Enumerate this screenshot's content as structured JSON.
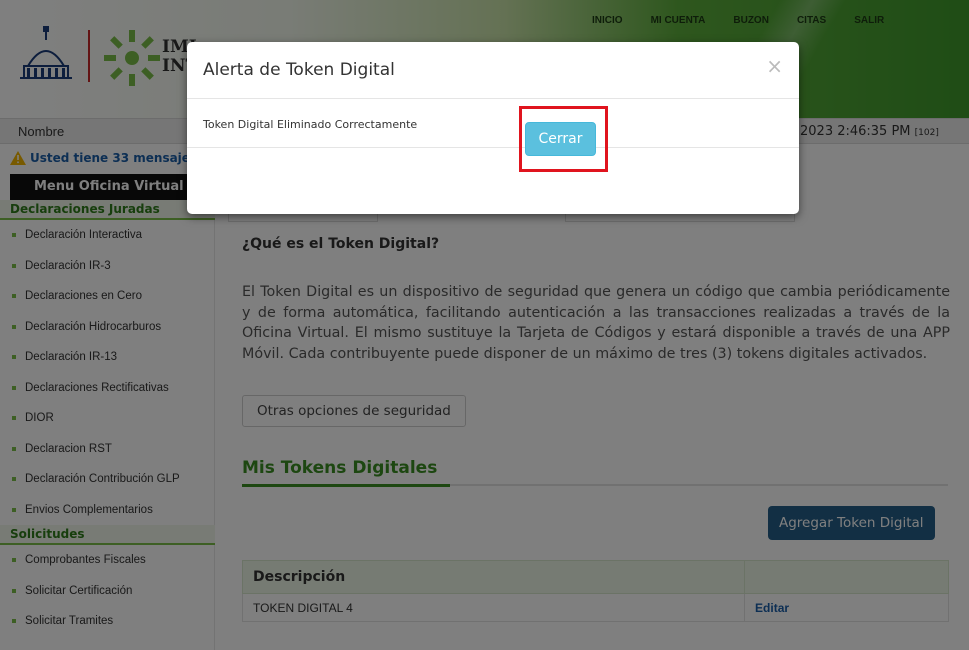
{
  "top_nav": [
    "INICIO",
    "MI CUENTA",
    "BUZON",
    "CITAS",
    "SALIR"
  ],
  "logo": {
    "text_line1": "IMI",
    "text_line2": "INT"
  },
  "info_bar": {
    "name_label": "Nombre",
    "datetime": "2023 2:46:35 PM",
    "code": "[102]"
  },
  "sidebar": {
    "alert": "Usted tiene 33 mensaje",
    "menu_title": "Menu Oficina Virtual",
    "section1": "Declaraciones Juradas",
    "items1": [
      "Declaración Interactiva",
      "Declaración IR-3",
      "Declaraciones en Cero",
      "Declaración Hidrocarburos",
      "Declaración IR-13",
      "Declaraciones Rectificativas",
      "DIOR",
      "Declaracion RST",
      "Declaración Contribución GLP",
      "Envios Complementarios"
    ],
    "section2": "Solicitudes",
    "items2": [
      "Comprobantes Fiscales",
      "Solicitar Certificación",
      "Solicitar Tramites"
    ]
  },
  "main": {
    "question": "¿Qué es el Token Digital?",
    "description": "El Token Digital es un dispositivo de seguridad que genera un código que cambia periódicamente y de forma automática, facilitando autenticación a las transacciones realizadas a través de la Oficina Virtual. El mismo sustituye la Tarjeta de Códigos y estará disponible a través de una APP Móvil. Cada contribuyente puede disponer de un máximo de tres (3) tokens digitales activados.",
    "other_options_button": "Otras opciones de seguridad",
    "tokens_title": "Mis Tokens Digitales",
    "add_token_button": "Agregar Token Digital",
    "table": {
      "headers": [
        "Descripción",
        ""
      ],
      "rows": [
        [
          "TOKEN DIGITAL 4",
          "Editar"
        ]
      ]
    }
  },
  "modal": {
    "title": "Alerta de Token Digital",
    "close_symbol": "×",
    "message": "Token Digital Eliminado Correctamente",
    "close_button": "Cerrar"
  },
  "colors": {
    "accent_green": "#3a8f22",
    "button_blue": "#245f88",
    "info_button": "#5bc0de",
    "highlight_red": "#e0141e"
  }
}
